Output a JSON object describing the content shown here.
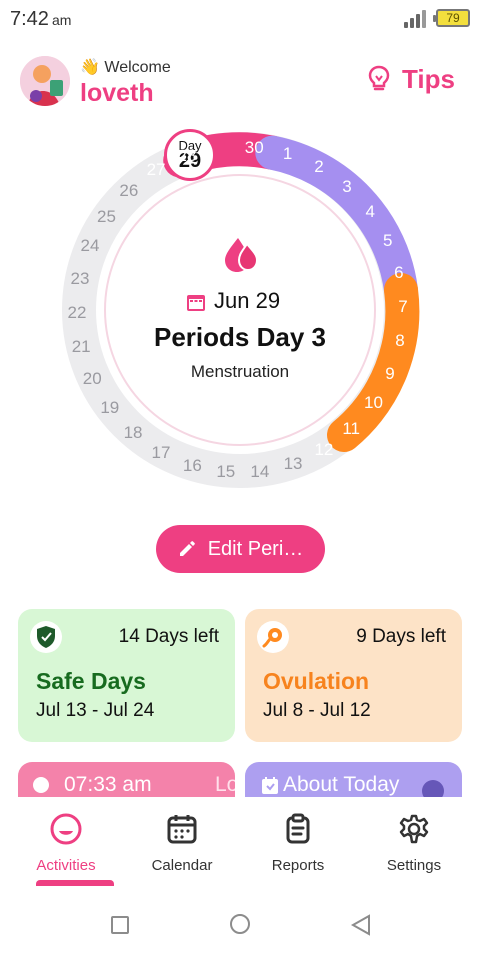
{
  "status": {
    "time": "7:42",
    "ampm": "am",
    "battery": "79"
  },
  "header": {
    "welcome": "Welcome",
    "username": "loveth",
    "tips_label": "Tips"
  },
  "cycle": {
    "marker_label": "Day",
    "marker_day": "29",
    "days": [
      "1",
      "2",
      "3",
      "4",
      "5",
      "6",
      "7",
      "8",
      "9",
      "10",
      "11",
      "12",
      "13",
      "14",
      "15",
      "16",
      "17",
      "18",
      "19",
      "20",
      "21",
      "22",
      "23",
      "24",
      "25",
      "26",
      "27",
      "28",
      "30"
    ]
  },
  "center": {
    "date": "Jun 29",
    "title": "Periods Day 3",
    "phase": "Menstruation"
  },
  "edit_button": {
    "label": "Edit Peri…"
  },
  "cards": {
    "safe": {
      "days_left": "14 Days left",
      "title": "Safe Days",
      "dates": "Jul 13 - Jul 24"
    },
    "ovulation": {
      "days_left": "9 Days left",
      "title": "Ovulation",
      "dates": "Jul 8 - Jul 12"
    }
  },
  "mini_cards": {
    "time": "07:33 am",
    "partial": "Lo",
    "about": "About Today"
  },
  "nav": {
    "items": [
      {
        "label": "Activities"
      },
      {
        "label": "Calendar"
      },
      {
        "label": "Reports"
      },
      {
        "label": "Settings"
      }
    ]
  },
  "colors": {
    "period": "#ee3f82",
    "fertile": "#a58ff0",
    "ovulation": "#ff8a1f",
    "safe": "#ececee",
    "safe_card": "#d8f7d5",
    "ovulation_card": "#fde3c7",
    "accent": "#ee3f82"
  },
  "icons": [
    "wave-icon",
    "lightbulb-icon",
    "droplet-icon",
    "calendar-icon",
    "pencil-icon",
    "shield-icon",
    "ovulation-icon",
    "clock-icon",
    "calendar-date-icon",
    "smile-icon",
    "calendar-grid-icon",
    "document-icon",
    "gear-icon"
  ]
}
